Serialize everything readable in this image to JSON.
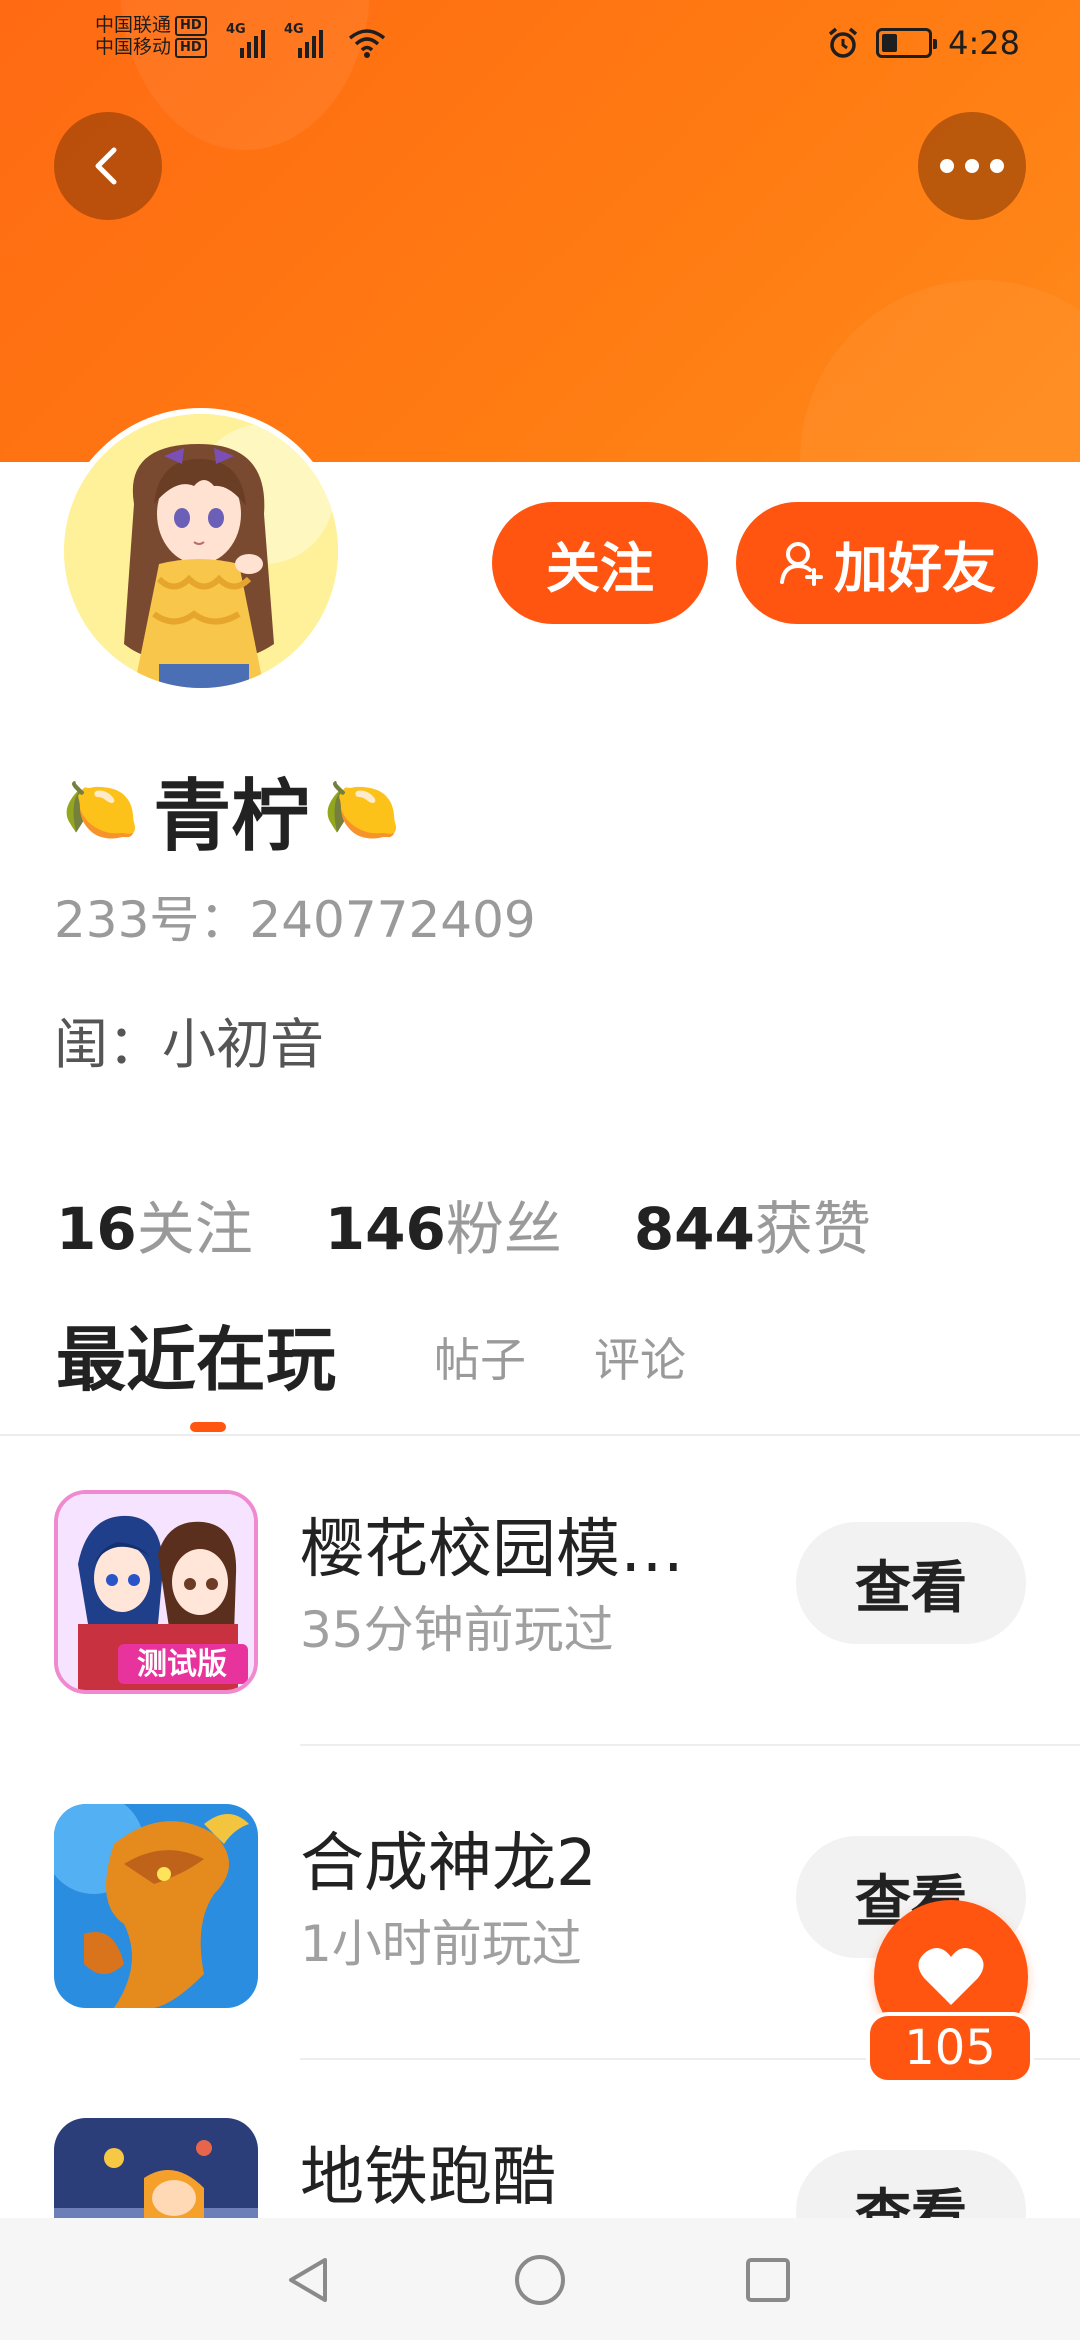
{
  "status_bar": {
    "carrier_1": "中国联通",
    "carrier_2": "中国移动",
    "hd_label": "HD",
    "network_1": "4G",
    "network_2": "4G",
    "time": "4:28",
    "battery_level": 0.35,
    "icons": [
      "signal-icon",
      "wifi-icon",
      "alarm-icon",
      "battery-icon"
    ]
  },
  "header": {
    "back_icon": "chevron-left-icon",
    "more_icon": "more-horizontal-icon",
    "colors": {
      "primary": "#ff6a13",
      "accent": "#ff5510"
    }
  },
  "profile": {
    "avatar_alt": "avatar",
    "follow_label": "关注",
    "add_friend_label": "加好友",
    "add_friend_icon": "user-add-icon",
    "name": "青柠",
    "name_emoji": "🍋",
    "id_line": "233号：240772409",
    "nick_line": "闺：小初音"
  },
  "stats": [
    {
      "value": "16",
      "label": "关注"
    },
    {
      "value": "146",
      "label": "粉丝"
    },
    {
      "value": "844",
      "label": "获赞"
    }
  ],
  "tabs": [
    {
      "label": "最近在玩",
      "active": true
    },
    {
      "label": "帖子",
      "active": false
    },
    {
      "label": "评论",
      "active": false
    }
  ],
  "games": [
    {
      "title": "樱花校园模…",
      "subtitle": "35分钟前玩过",
      "action": "查看",
      "icon_badge": "测试版"
    },
    {
      "title": "合成神龙2",
      "subtitle": "1小时前玩过",
      "action": "查看"
    },
    {
      "title": "地铁跑酷",
      "subtitle": "",
      "action": "查看"
    }
  ],
  "like": {
    "icon": "heart-icon",
    "count": "105"
  },
  "navbar": {
    "icons": [
      "back-triangle-icon",
      "home-circle-icon",
      "recents-square-icon"
    ]
  }
}
